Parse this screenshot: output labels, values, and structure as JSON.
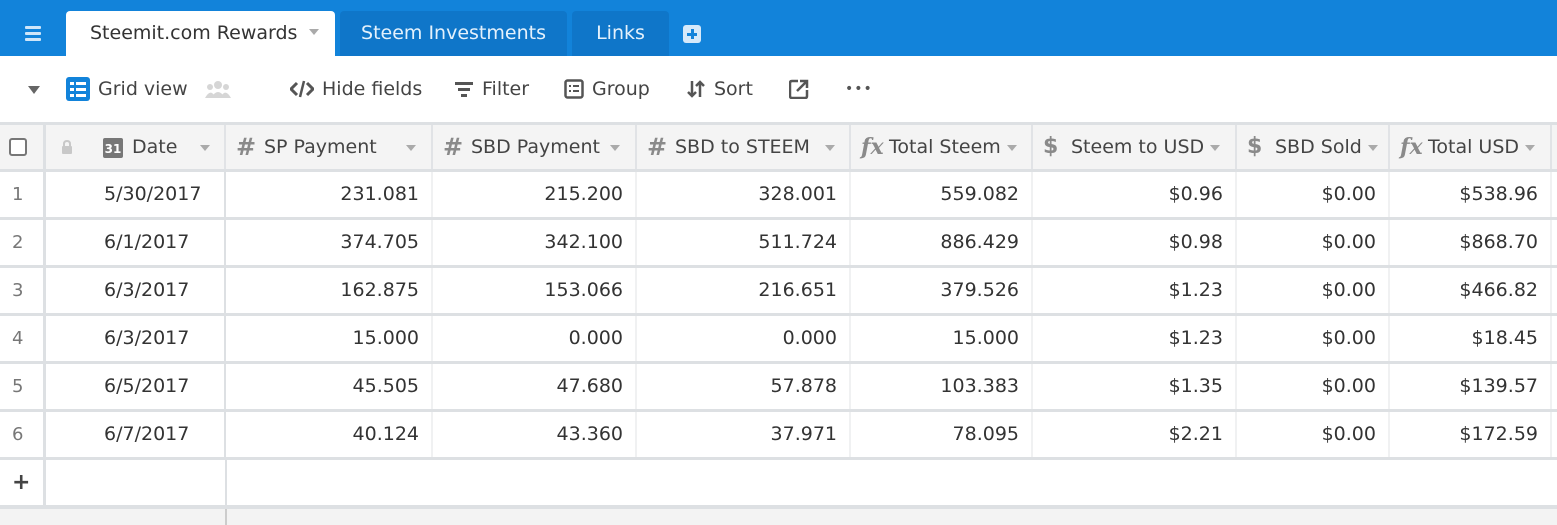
{
  "topbar": {
    "tabs": [
      {
        "label": "Steemit.com Rewards",
        "active": true
      },
      {
        "label": "Steem Investments",
        "active": false
      },
      {
        "label": "Links",
        "active": false
      }
    ],
    "icons": {
      "menu": "hamburger-icon",
      "add_table": "plus-square-icon"
    },
    "accent_color": "#1283da"
  },
  "toolbar": {
    "view_name": "Grid view",
    "hide_fields": "Hide fields",
    "filter": "Filter",
    "group": "Group",
    "sort": "Sort",
    "more": "•••"
  },
  "grid": {
    "columns": [
      {
        "name": "Date",
        "type": "date",
        "icon": "calendar-icon",
        "glyph": "31"
      },
      {
        "name": "SP Payment",
        "type": "number",
        "icon": "hash-icon",
        "glyph": "#"
      },
      {
        "name": "SBD Payment",
        "type": "number",
        "icon": "hash-icon",
        "glyph": "#"
      },
      {
        "name": "SBD to STEEM",
        "type": "number",
        "icon": "hash-icon",
        "glyph": "#"
      },
      {
        "name": "Total Steem",
        "type": "formula",
        "icon": "formula-icon",
        "glyph": "fx"
      },
      {
        "name": "Steem to USD",
        "type": "currency",
        "icon": "currency-icon",
        "glyph": "$"
      },
      {
        "name": "SBD Sold",
        "type": "currency",
        "icon": "currency-icon",
        "glyph": "$"
      },
      {
        "name": "Total USD",
        "type": "formula",
        "icon": "formula-icon",
        "glyph": "fx"
      }
    ],
    "rows": [
      {
        "num": "1",
        "cells": [
          "5/30/2017",
          "231.081",
          "215.200",
          "328.001",
          "559.082",
          "$0.96",
          "$0.00",
          "$538.96"
        ]
      },
      {
        "num": "2",
        "cells": [
          "6/1/2017",
          "374.705",
          "342.100",
          "511.724",
          "886.429",
          "$0.98",
          "$0.00",
          "$868.70"
        ]
      },
      {
        "num": "3",
        "cells": [
          "6/3/2017",
          "162.875",
          "153.066",
          "216.651",
          "379.526",
          "$1.23",
          "$0.00",
          "$466.82"
        ]
      },
      {
        "num": "4",
        "cells": [
          "6/3/2017",
          "15.000",
          "0.000",
          "0.000",
          "15.000",
          "$1.23",
          "$0.00",
          "$18.45"
        ]
      },
      {
        "num": "5",
        "cells": [
          "6/5/2017",
          "45.505",
          "47.680",
          "57.878",
          "103.383",
          "$1.35",
          "$0.00",
          "$139.57"
        ]
      },
      {
        "num": "6",
        "cells": [
          "6/7/2017",
          "40.124",
          "43.360",
          "37.971",
          "78.095",
          "$2.21",
          "$0.00",
          "$172.59"
        ]
      }
    ],
    "add_row": "+"
  }
}
